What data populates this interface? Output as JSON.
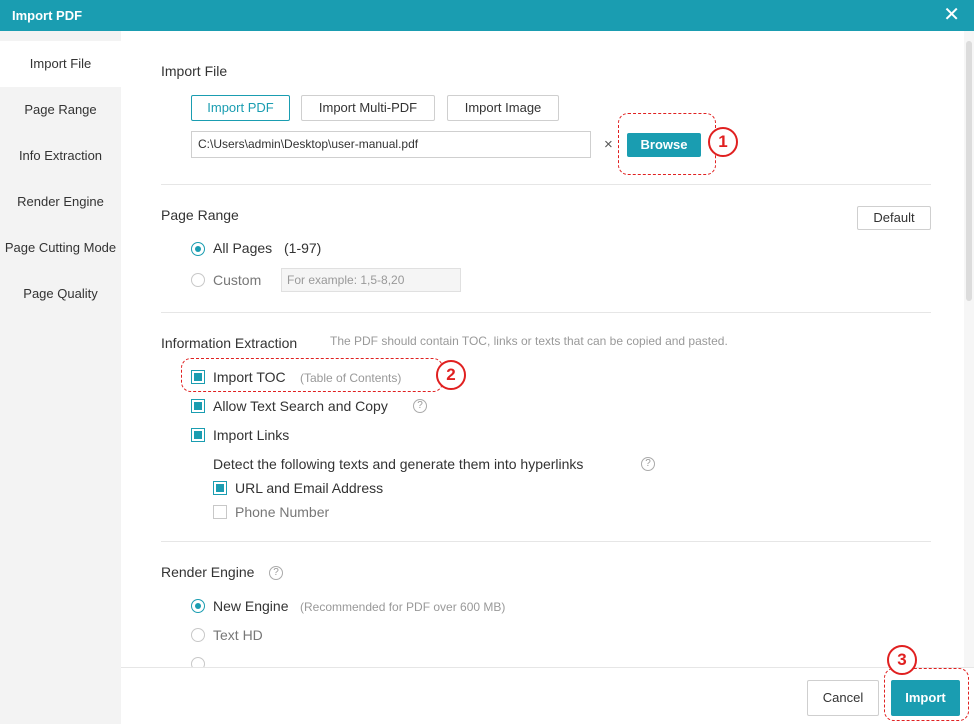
{
  "window": {
    "title": "Import PDF",
    "close_glyph": "✕"
  },
  "sidebar": {
    "items": [
      {
        "label": "Import File"
      },
      {
        "label": "Page Range"
      },
      {
        "label": "Info Extraction"
      },
      {
        "label": "Render Engine"
      },
      {
        "label": "Page Cutting Mode"
      },
      {
        "label": "Page Quality"
      }
    ]
  },
  "import_file": {
    "title": "Import File",
    "tabs": [
      "Import PDF",
      "Import Multi-PDF",
      "Import Image"
    ],
    "path_value": "C:\\Users\\admin\\Desktop\\user-manual.pdf",
    "clear_glyph": "×",
    "browse_label": "Browse"
  },
  "page_range": {
    "title": "Page Range",
    "default_label": "Default",
    "all_pages_label": "All Pages",
    "all_pages_range": "(1-97)",
    "custom_label": "Custom",
    "custom_placeholder": "For example: 1,5-8,20"
  },
  "info_extraction": {
    "title": "Information Extraction",
    "hint": "The PDF should contain TOC, links or texts that can be copied and pasted.",
    "import_toc_label": "Import TOC",
    "import_toc_hint": "(Table of Contents)",
    "allow_text_label": "Allow Text Search and Copy",
    "import_links_label": "Import Links",
    "detect_text": "Detect the following texts and generate them into hyperlinks",
    "url_email_label": "URL and Email Address",
    "phone_label": "Phone Number",
    "help_glyph": "?"
  },
  "render_engine": {
    "title": "Render Engine",
    "new_engine_label": "New Engine",
    "new_engine_hint": "(Recommended for PDF over 600 MB)",
    "text_hd_label": "Text HD"
  },
  "footer": {
    "cancel_label": "Cancel",
    "import_label": "Import"
  },
  "annotations": [
    "1",
    "2",
    "3"
  ],
  "colors": {
    "accent": "#1a9db1",
    "annotation": "#e02020"
  }
}
